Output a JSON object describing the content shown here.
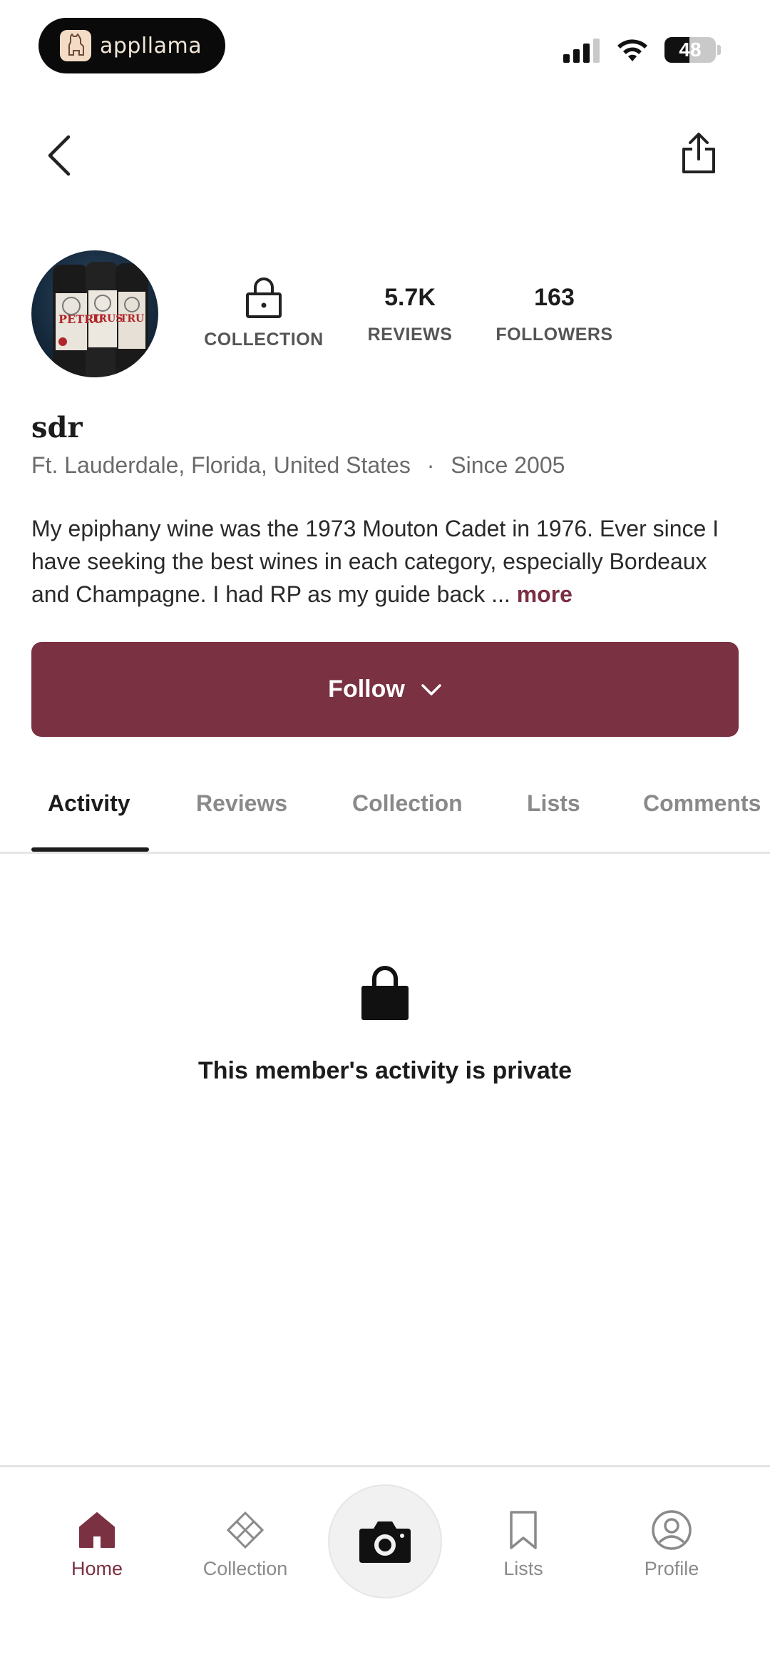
{
  "status_bar": {
    "app_name": "appllama",
    "battery": "48",
    "battery_level": 0.48
  },
  "nav": {
    "back_icon": "chevron-left-icon",
    "share_icon": "share-icon"
  },
  "profile": {
    "username": "sdr",
    "location": "Ft. Lauderdale, Florida, United States",
    "separator": "·",
    "since": "Since 2005",
    "bio": "My epiphany wine was the 1973 Mouton Cadet in 1976. Ever since I have seeking the best wines in each category, especially Bordeaux and Champagne. I had RP as my guide back ...",
    "more_label": "more",
    "stats": {
      "collection_label": "COLLECTION",
      "reviews_value": "5.7K",
      "reviews_label": "REVIEWS",
      "followers_value": "163",
      "followers_label": "FOLLOWERS"
    },
    "follow_label": "Follow"
  },
  "tabs": [
    {
      "label": "Activity",
      "active": true
    },
    {
      "label": "Reviews",
      "active": false
    },
    {
      "label": "Collection",
      "active": false
    },
    {
      "label": "Lists",
      "active": false
    },
    {
      "label": "Comments",
      "active": false
    }
  ],
  "private_notice": "This member's activity is private",
  "bottom_nav": {
    "home": "Home",
    "collection": "Collection",
    "lists": "Lists",
    "profile": "Profile"
  },
  "colors": {
    "accent": "#7a3142",
    "muted_text": "#8a8a8a"
  }
}
